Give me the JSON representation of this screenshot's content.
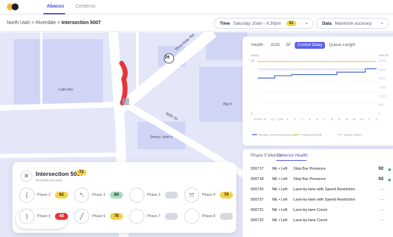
{
  "topbar": {
    "tabs": [
      {
        "label": "Abacus"
      },
      {
        "label": "Cerberus"
      }
    ]
  },
  "breadcrumb": {
    "items": [
      "North Utah",
      "Riverdale",
      "Intersection 5007"
    ],
    "separator": ">"
  },
  "time_filter": {
    "label": "Time",
    "value": "Saturday 10am - 6:30pm",
    "badge": "61"
  },
  "data_filter": {
    "label": "Data",
    "value": "Maximize accuracy"
  },
  "map": {
    "route_badge": "26",
    "labels": {
      "riverdale_rd": "Riverdale Rd",
      "fortieth_st": "40th St",
      "cafe_rio": "Cafe Rio",
      "big5": "Big 5",
      "jimmy_johns": "Jimmy John's"
    },
    "colors": {
      "background": "#e4e7f8",
      "building": "#cfd4f4",
      "road": "#ffffff",
      "route": "#e8333a"
    }
  },
  "chart_panel": {
    "tabs": [
      {
        "label": "Health"
      },
      {
        "label": "AOG"
      },
      {
        "label": "SF"
      },
      {
        "label": "Control Delay"
      },
      {
        "label": "Queue Length"
      }
    ],
    "active_tab": "Control Delay"
  },
  "chart_data": {
    "type": "line",
    "left_axis_label": "Delay",
    "right_axis_label": "Veh/Hr",
    "left_ticks": [
      "40",
      "",
      "",
      "0"
    ],
    "left_ticks_display": [
      "40",
      "",
      "",
      "0"
    ],
    "right_ticks": [
      "3000",
      "2500",
      "2000",
      "1500",
      "1000",
      "500",
      "0"
    ],
    "x_ticks": [
      "10am",
      "11",
      "12",
      "1",
      "2",
      "3",
      "4",
      "5",
      "6",
      "7",
      "8",
      "9",
      "10",
      "11",
      "12",
      "1",
      "2"
    ],
    "x_ticks_display": [
      "10 am",
      "11",
      "12",
      "1 pm",
      "2",
      "3",
      "4",
      "5",
      "6",
      "7",
      "8",
      "9",
      "10",
      "11",
      "12",
      "1",
      "2"
    ],
    "series": [
      {
        "name": "Average Control Delay (seconds)",
        "color": "#2c56c8",
        "axis": "left",
        "values": [
          30,
          30,
          30,
          32,
          32,
          32,
          33,
          33,
          33,
          33,
          33,
          33,
          33,
          33,
          35,
          35,
          35,
          35,
          35,
          38,
          38,
          38
        ]
      },
      {
        "name": "Programmed Split",
        "color": "#f4c435",
        "axis": "left",
        "values": [
          44,
          44,
          44,
          44,
          44,
          44,
          44,
          44,
          44,
          44,
          44,
          44,
          44,
          44,
          44,
          44,
          44,
          44,
          44,
          44,
          44,
          44
        ]
      },
      {
        "name": "Volume (veh/hr)",
        "color": "#c9ccf3",
        "axis": "right",
        "values": [
          2500,
          2500,
          2500,
          2500,
          2500,
          2500,
          2500,
          2500,
          2500,
          2500,
          2500,
          2500,
          2500,
          2500,
          2500,
          2500,
          2500,
          2500,
          2500,
          2500,
          2500,
          2500
        ]
      }
    ],
    "ylim": [
      0,
      45
    ],
    "y2lim": [
      0,
      3000
    ],
    "legend_position": "bottom"
  },
  "detector_panel": {
    "tabs": [
      {
        "label": "Phase 5 Metrics"
      },
      {
        "label": "Detector Health"
      }
    ],
    "active_tab": "Detector Health",
    "rows": [
      {
        "id": "500717",
        "dir": "NE • Left",
        "desc": "Stop Bar Presence",
        "value": "92",
        "status": "ok"
      },
      {
        "id": "500718",
        "dir": "NE • Left",
        "desc": "Stop Bar Presence",
        "value": "92",
        "status": "ok"
      },
      {
        "id": "500726",
        "dir": "NE • Left",
        "desc": "Lane-by-lane with Speed Restriction",
        "value": "—",
        "status": "none"
      },
      {
        "id": "500727",
        "dir": "NE • Left",
        "desc": "Lane-by-lane with Speed Restriction",
        "value": "—",
        "status": "none"
      },
      {
        "id": "500721",
        "dir": "NE • Left",
        "desc": "Lane-by-lane Count",
        "value": "—",
        "status": "none"
      },
      {
        "id": "500722",
        "dir": "NE • Left",
        "desc": "Lane-by-lane Count",
        "value": "—",
        "status": "none"
      }
    ]
  },
  "intersection": {
    "title": "Intersection 5007",
    "subtitle": "Riverdale Rd 4500",
    "score": "72",
    "phases": [
      {
        "label": "Phase 1",
        "value": "62",
        "color": "#f4d34a",
        "icon": "turn-left-icon"
      },
      {
        "label": "Phase 2",
        "value": "84",
        "color": "#a8dcc0",
        "icon": "merge-arrow-icon"
      },
      {
        "label": "Phase 3",
        "value": "",
        "color": "#d7d9e2",
        "icon": "empty-icon"
      },
      {
        "label": "Phase 4",
        "value": "70",
        "color": "#f4d34a",
        "icon": "cross-arrows-icon"
      },
      {
        "label": "Phase 5",
        "value": "48",
        "color": "#e8333a",
        "icon": "turn-right-icon"
      },
      {
        "label": "Phase 6",
        "value": "76",
        "color": "#f4d34a",
        "icon": "diagonal-arrow-icon"
      },
      {
        "label": "Phase 7",
        "value": "",
        "color": "#d7d9e2",
        "icon": "empty-icon"
      },
      {
        "label": "Phase 8",
        "value": "",
        "color": "#d7d9e2",
        "icon": "empty-icon"
      }
    ]
  }
}
